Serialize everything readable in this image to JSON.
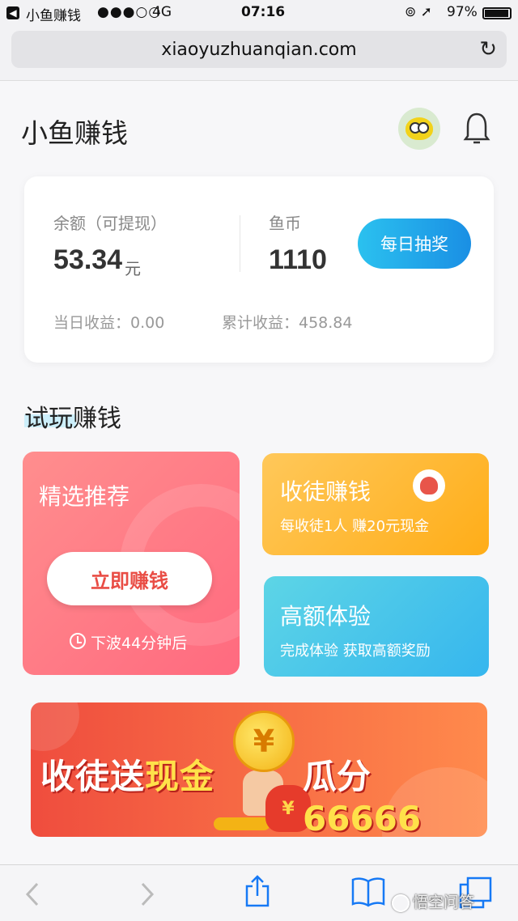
{
  "status_bar": {
    "app_back": "小鱼赚钱",
    "signal": "●●●○○",
    "network": "4G",
    "time": "07:16",
    "battery": "97%"
  },
  "browser": {
    "url": "xiaoyuzhuanqian.com",
    "back_icon": "chevron-left-icon",
    "forward_icon": "chevron-right-icon",
    "share_icon": "share-icon",
    "bookmarks_icon": "book-icon",
    "tabs_icon": "tabs-icon"
  },
  "header": {
    "title": "小鱼赚钱"
  },
  "balance_card": {
    "balance_label": "余额（可提现）",
    "balance_value": "53.34",
    "balance_unit": "元",
    "coin_label": "鱼币",
    "coin_value": "1110",
    "lottery_button": "每日抽奖",
    "daily_earnings": "当日收益：0.00",
    "total_earnings": "累计收益：458.84"
  },
  "section": {
    "title": "试玩赚钱"
  },
  "tiles": {
    "featured": {
      "title": "精选推荐",
      "button": "立即赚钱",
      "next_wave": "下波44分钟后"
    },
    "invite": {
      "title": "收徒赚钱",
      "subtitle": "每收徒1人 赚20元现金"
    },
    "experience": {
      "title": "高额体验",
      "subtitle": "完成体验 获取高额奖励"
    }
  },
  "banner": {
    "left_plain": "收徒送",
    "left_gold": "现金",
    "right_plain": "瓜分",
    "right_gold": "66666",
    "coin_symbol": "¥",
    "bag_symbol": "¥"
  },
  "watermark": {
    "text": "悟空问答"
  },
  "colors": {
    "accent_blue": "#1a8fe4",
    "featured_pink": "#ff6a7f",
    "invite_orange": "#ffad18",
    "experience_blue": "#36b6ee",
    "banner_red": "#ef4d3e"
  }
}
